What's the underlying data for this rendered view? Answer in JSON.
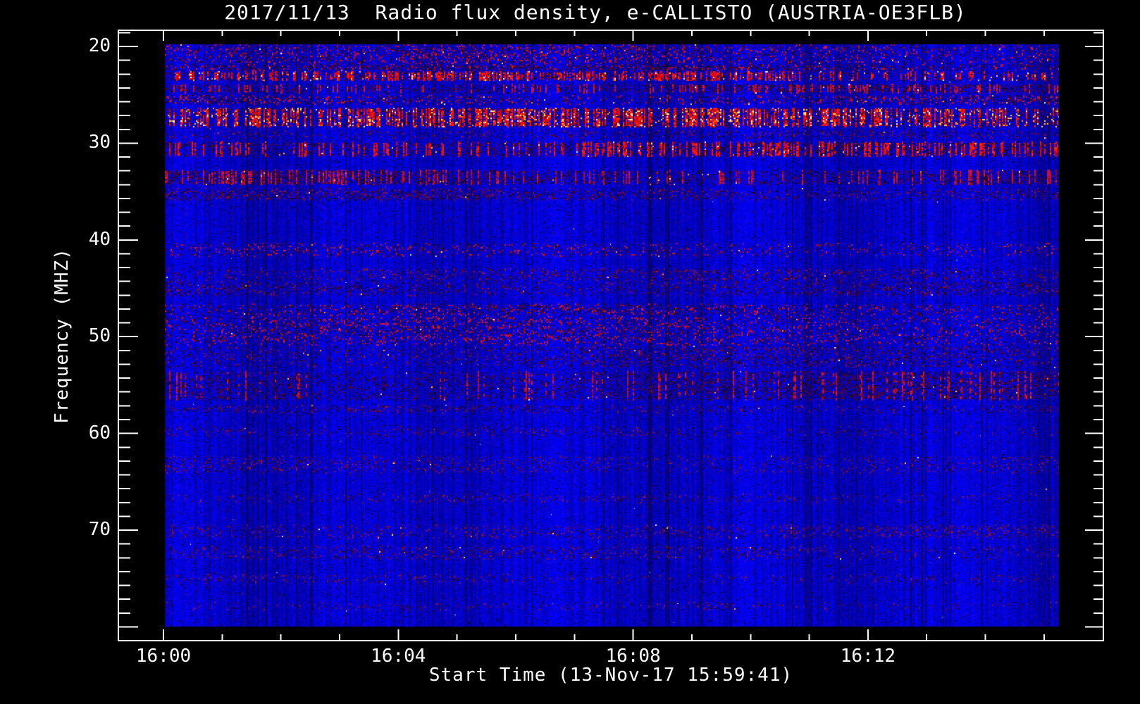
{
  "window": {
    "background": "#000000",
    "foreground": "#ffffff"
  },
  "chart_data": {
    "type": "heatmap",
    "title": "2017/11/13  Radio flux density, e-CALLISTO (AUSTRIA-OE3FLB)",
    "xlabel": "Start Time (13-Nov-17 15:59:41)",
    "ylabel": "Frequency (MHZ)",
    "x_tick_labels": [
      "16:00",
      "16:04",
      "16:08",
      "16:12"
    ],
    "x_tick_interval_minutes": 4,
    "x_minor_ticks_per_interval": 3,
    "x_start": "15:59:41",
    "duration_minutes_approx": 16,
    "y_tick_labels": [
      "20",
      "30",
      "40",
      "50",
      "60",
      "70"
    ],
    "y_axis_direction": "inverted, 20 MHz at top",
    "ylim": [
      19.8,
      80.2
    ],
    "grid": false,
    "legend": "none",
    "colormap_description": "blue noise background with red/orange RFI interference bands",
    "colors": {
      "base_blue": "#0a00f0",
      "dark_blue": "#000040",
      "rfi_red": "#e81800",
      "rfi_orange": "#ff8800",
      "rfi_yellow": "#ffcc33",
      "muted_purple": "#701858",
      "axis": "#ffffff",
      "background": "#000000"
    },
    "rfi_bands": [
      {
        "f0": 19.8,
        "f1": 21.8,
        "red": 0.2,
        "dark": 0.22,
        "spark": 0.004,
        "wave": 0,
        "columnar": false,
        "tier": 1
      },
      {
        "f0": 21.8,
        "f1": 22.5,
        "red": 0.15,
        "dark": 0.5,
        "spark": 0.002,
        "wave": 0,
        "columnar": false,
        "tier": 1
      },
      {
        "f0": 22.5,
        "f1": 23.5,
        "red": 0.55,
        "dark": 0.32,
        "spark": 0.02,
        "wave": 0,
        "columnar": true,
        "tier": 2
      },
      {
        "f0": 23.8,
        "f1": 24.9,
        "red": 0.3,
        "dark": 0.45,
        "spark": 0.004,
        "wave": 0,
        "columnar": true,
        "tier": 1
      },
      {
        "f0": 25.0,
        "f1": 26.1,
        "red": 0.22,
        "dark": 0.3,
        "spark": 0.003,
        "wave": 0,
        "columnar": false,
        "tier": 1
      },
      {
        "f0": 26.4,
        "f1": 28.4,
        "red": 0.62,
        "dark": 0.35,
        "spark": 0.05,
        "wave": 0,
        "columnar": true,
        "tier": 2
      },
      {
        "f0": 28.7,
        "f1": 29.5,
        "red": 0.12,
        "dark": 0.18,
        "spark": 0.001,
        "wave": 0,
        "columnar": false,
        "tier": 0
      },
      {
        "f0": 29.8,
        "f1": 31.4,
        "red": 0.4,
        "dark": 0.42,
        "spark": 0.008,
        "wave": 0,
        "columnar": true,
        "tier": 2
      },
      {
        "f0": 32.7,
        "f1": 34.3,
        "red": 0.28,
        "dark": 0.5,
        "spark": 0.004,
        "wave": 0,
        "columnar": true,
        "tier": 1
      },
      {
        "f0": 34.7,
        "f1": 35.9,
        "red": 0.16,
        "dark": 0.3,
        "spark": 0.001,
        "wave": 0,
        "columnar": false,
        "tier": 0
      },
      {
        "f0": 40.3,
        "f1": 41.8,
        "red": 0.18,
        "dark": 0.15,
        "spark": 0.001,
        "wave": 1,
        "columnar": false,
        "tier": 1
      },
      {
        "f0": 42.9,
        "f1": 44.3,
        "red": 0.22,
        "dark": 0.22,
        "spark": 0.001,
        "wave": 1,
        "columnar": false,
        "tier": 0
      },
      {
        "f0": 44.3,
        "f1": 45.8,
        "red": 0.14,
        "dark": 0.28,
        "spark": 0.001,
        "wave": 1,
        "columnar": false,
        "tier": 0
      },
      {
        "f0": 46.5,
        "f1": 47.9,
        "red": 0.22,
        "dark": 0.3,
        "spark": 0.001,
        "wave": 1,
        "columnar": false,
        "tier": 1
      },
      {
        "f0": 47.9,
        "f1": 50.9,
        "red": 0.28,
        "dark": 0.22,
        "spark": 0.001,
        "wave": 1,
        "columnar": false,
        "tier": 1
      },
      {
        "f0": 50.9,
        "f1": 53.3,
        "red": 0.16,
        "dark": 0.25,
        "spark": 0.001,
        "wave": 1,
        "columnar": false,
        "tier": 0
      },
      {
        "f0": 53.5,
        "f1": 56.6,
        "red": 0.22,
        "dark": 0.48,
        "spark": 0.002,
        "wave": 1,
        "columnar": true,
        "tier": 1
      },
      {
        "f0": 57.0,
        "f1": 57.9,
        "red": 0.1,
        "dark": 0.18,
        "spark": 0.001,
        "wave": 0,
        "columnar": false,
        "tier": 0
      },
      {
        "f0": 59.3,
        "f1": 60.4,
        "red": 0.07,
        "dark": 0.1,
        "spark": 0.0,
        "wave": 0,
        "columnar": false,
        "tier": 0
      },
      {
        "f0": 62.3,
        "f1": 64.2,
        "red": 0.12,
        "dark": 0.1,
        "spark": 0.001,
        "wave": 0,
        "columnar": false,
        "tier": 0
      },
      {
        "f0": 66.2,
        "f1": 67.3,
        "red": 0.08,
        "dark": 0.08,
        "spark": 0.0,
        "wave": 0,
        "columnar": false,
        "tier": 0
      },
      {
        "f0": 69.4,
        "f1": 70.9,
        "red": 0.16,
        "dark": 0.1,
        "spark": 0.001,
        "wave": 0,
        "columnar": false,
        "tier": 0
      },
      {
        "f0": 71.6,
        "f1": 73.1,
        "red": 0.12,
        "dark": 0.1,
        "spark": 0.001,
        "wave": 0,
        "columnar": false,
        "tier": 0
      },
      {
        "f0": 74.5,
        "f1": 75.6,
        "red": 0.08,
        "dark": 0.08,
        "spark": 0.0,
        "wave": 0,
        "columnar": false,
        "tier": 0
      },
      {
        "f0": 77.4,
        "f1": 78.3,
        "red": 0.06,
        "dark": 0.07,
        "spark": 0.0,
        "wave": 0,
        "columnar": false,
        "tier": 0
      }
    ],
    "sparkle_dots": 70
  }
}
